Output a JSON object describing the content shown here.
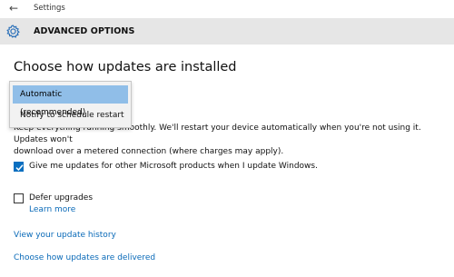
{
  "window": {
    "title": "Settings"
  },
  "header": {
    "title": "ADVANCED OPTIONS"
  },
  "main": {
    "section_title": "Choose how updates are installed",
    "dropdown": {
      "selected": "Automatic (recommended)",
      "options": [
        "Automatic (recommended)",
        "Notify to schedule restart"
      ]
    },
    "description_line1": "Keep everything running smoothly. We'll restart your device automatically when you're not using it. Updates won't",
    "description_line2": "download over a metered connection (where charges may apply).",
    "other_products": {
      "label": "Give me updates for other Microsoft products when I update Windows.",
      "checked": true
    },
    "defer": {
      "label": "Defer upgrades",
      "checked": false,
      "learn_more": "Learn more"
    },
    "links": {
      "history": "View your update history",
      "delivery": "Choose how updates are delivered"
    }
  },
  "colors": {
    "accent": "#0a6fc0",
    "link": "#0a6ab8",
    "header_bg": "#e6e6e6",
    "selection": "#90bee8"
  },
  "icons": [
    "back-arrow-icon",
    "gear-icon",
    "checkmark-icon"
  ]
}
